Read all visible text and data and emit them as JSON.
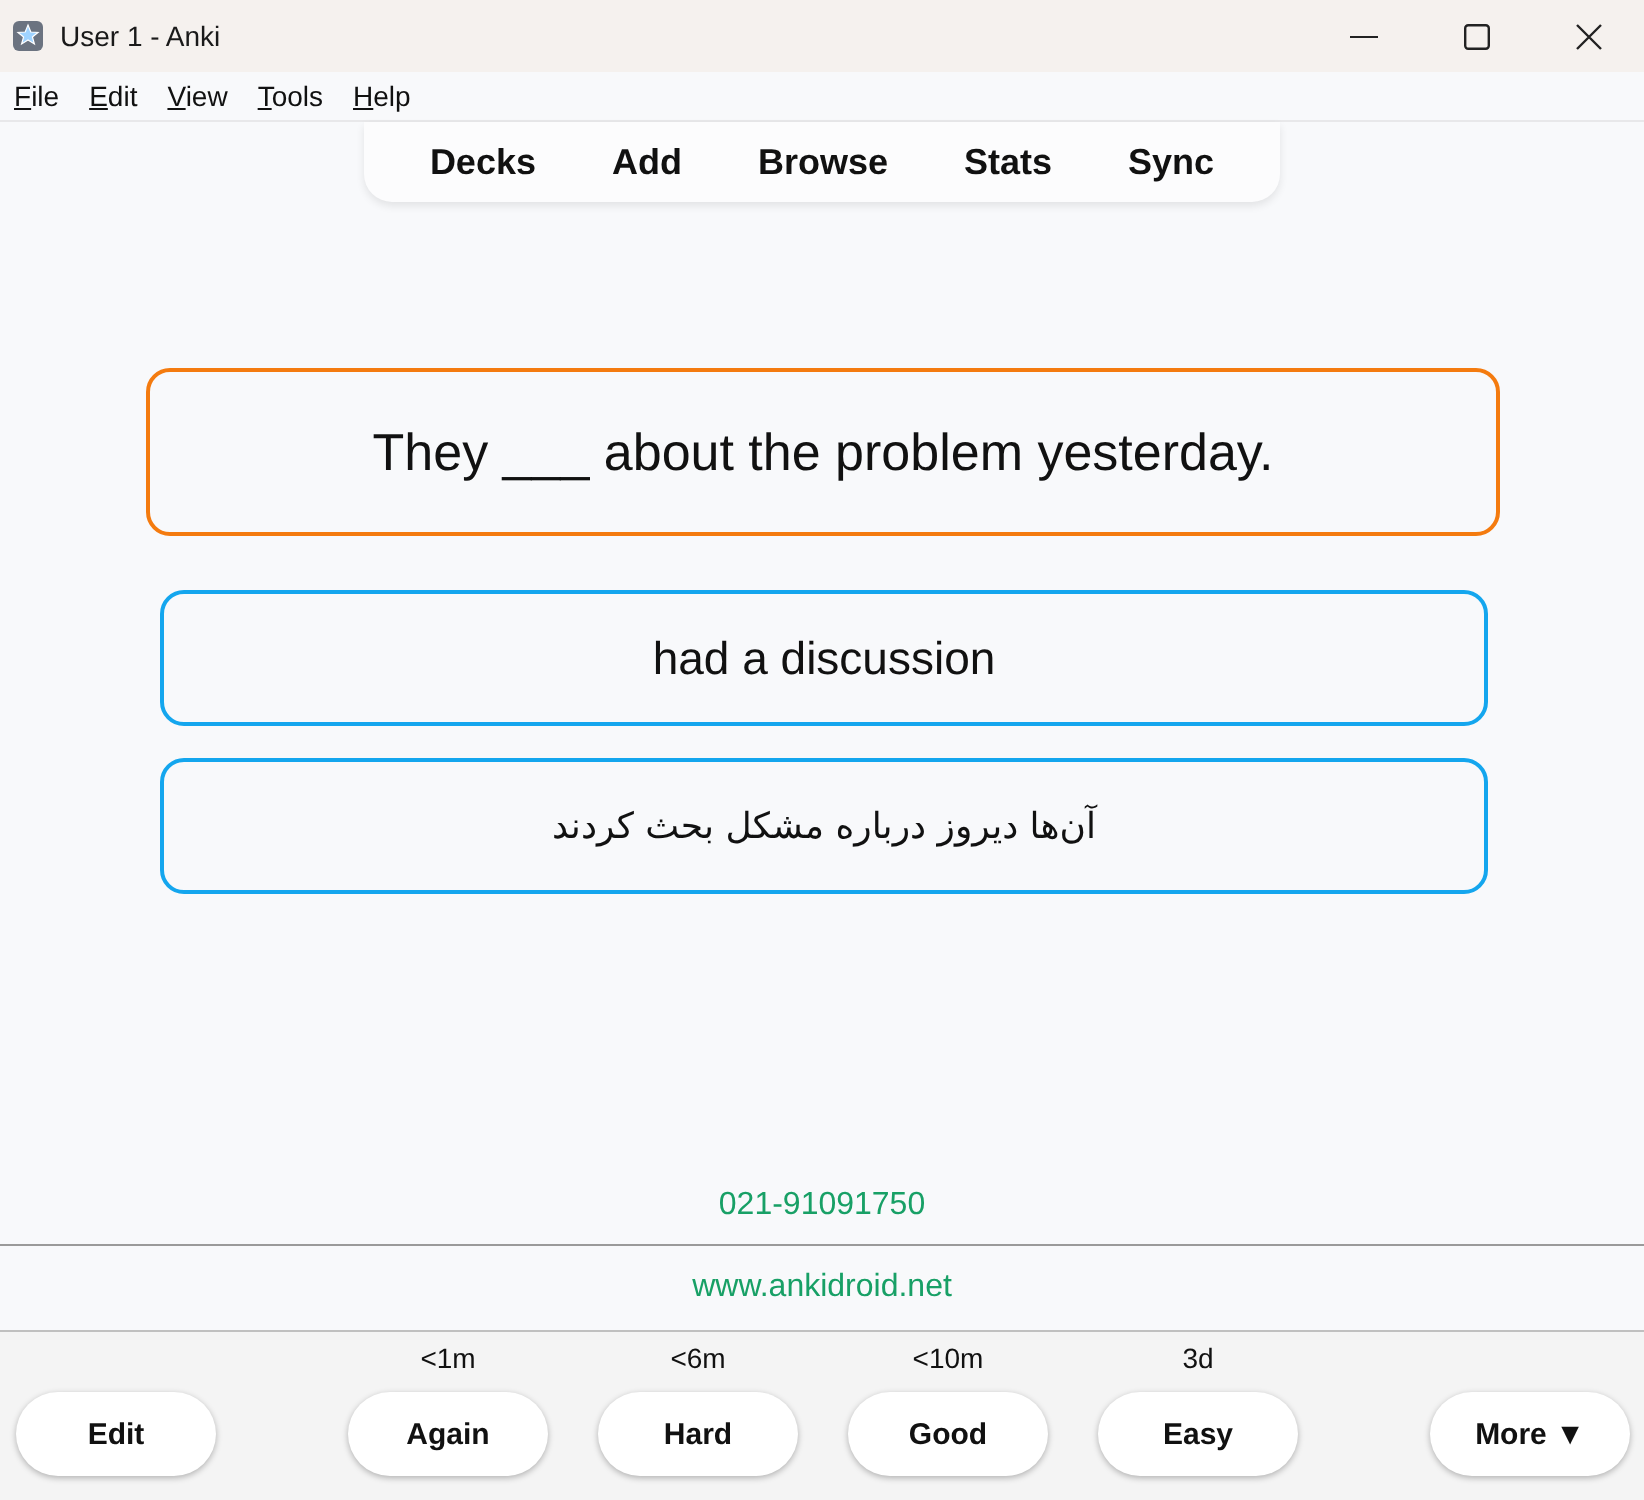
{
  "window": {
    "title": "User 1 - Anki"
  },
  "menu": [
    "File",
    "Edit",
    "View",
    "Tools",
    "Help"
  ],
  "toolbar": [
    "Decks",
    "Add",
    "Browse",
    "Stats",
    "Sync"
  ],
  "card": {
    "question": "They ___ about the problem yesterday.",
    "answers": [
      {
        "kind": "text",
        "text": "had a discussion"
      },
      {
        "kind": "translation",
        "text": "آن‌ها دیروز درباره مشکل بحث کردند"
      }
    ]
  },
  "footer": {
    "phone": "021-91091750",
    "website": "www.ankidroid.net"
  },
  "bottom_bar": {
    "edit": "Edit",
    "answers": [
      {
        "interval": "<1m",
        "label": "Again"
      },
      {
        "interval": "<6m",
        "label": "Hard"
      },
      {
        "interval": "<10m",
        "label": "Good"
      },
      {
        "interval": "3d",
        "label": "Easy"
      }
    ],
    "more": "More ▼"
  }
}
